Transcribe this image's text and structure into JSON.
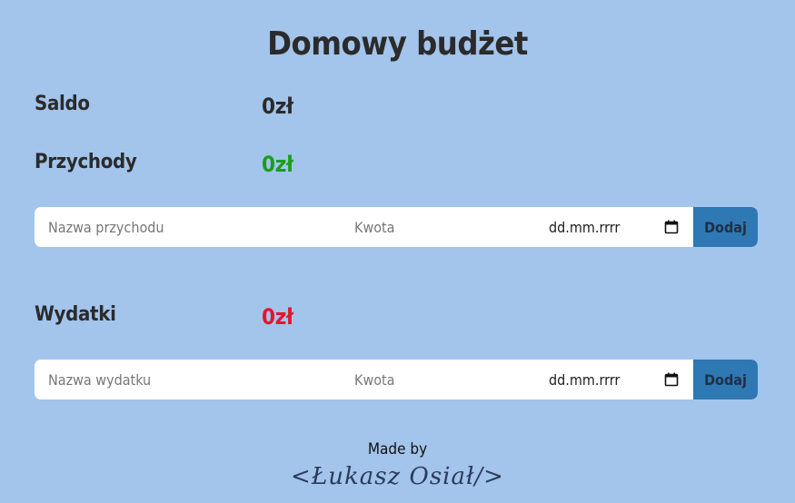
{
  "header": {
    "title": "Domowy budżet"
  },
  "balance": {
    "label": "Saldo",
    "value": "0zł"
  },
  "income": {
    "label": "Przychody",
    "value": "0zł",
    "value_color": "#1a9e1a",
    "form": {
      "name_placeholder": "Nazwa przychodu",
      "amount_placeholder": "Kwota",
      "date_placeholder": "dd.mm.rrrr",
      "submit_label": "Dodaj"
    }
  },
  "expenses": {
    "label": "Wydatki",
    "value": "0zł",
    "value_color": "#e8132b",
    "form": {
      "name_placeholder": "Nazwa wydatku",
      "amount_placeholder": "Kwota",
      "date_placeholder": "dd.mm.rrrr",
      "submit_label": "Dodaj"
    }
  },
  "footer": {
    "made_by": "Made by",
    "signature": "<Łukasz Osiał/>"
  },
  "colors": {
    "background": "#a3c4eb",
    "button": "#2e78b3"
  },
  "icons": {
    "date_picker": "calendar-icon"
  }
}
